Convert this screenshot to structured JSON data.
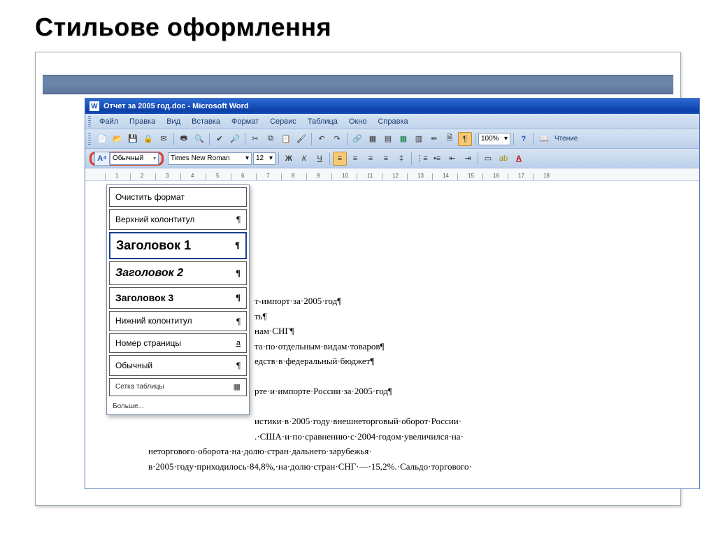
{
  "slide": {
    "title": "Стильове оформлення"
  },
  "window": {
    "title": "Отчет за 2005 год.doc - Microsoft Word"
  },
  "menu": {
    "file": "Файл",
    "edit": "Правка",
    "view": "Вид",
    "insert": "Вставка",
    "format": "Формат",
    "tools": "Сервис",
    "table": "Таблица",
    "window": "Окно",
    "help": "Справка"
  },
  "toolbar": {
    "zoom": "100%",
    "reading": "Чтение"
  },
  "format_bar": {
    "style": "Обычный",
    "font": "Times New Roman",
    "size": "12",
    "bold": "Ж",
    "italic": "К",
    "underline": "Ч"
  },
  "ruler": {
    "marks": [
      "1",
      "2",
      "3",
      "4",
      "5",
      "6",
      "7",
      "8",
      "9",
      "10",
      "11",
      "12",
      "13",
      "14",
      "15",
      "16",
      "17",
      "18"
    ]
  },
  "style_dropdown": {
    "clear": "Очистить формат",
    "header_top": "Верхний колонтитул",
    "h1": "Заголовок 1",
    "h2": "Заголовок 2",
    "h3": "Заголовок 3",
    "header_bottom": "Нижний колонтитул",
    "page_num": "Номер страницы",
    "normal": "Обычный",
    "table_grid": "Сетка таблицы",
    "more": "Больше..."
  },
  "document": {
    "lines": [
      "т-импорт·за·2005·год¶",
      "ть¶",
      "нам·СНГ¶",
      "та·по·отдельным·видам·товаров¶",
      "едств·в·федеральный·бюджет¶",
      "",
      "рте·и·импорте·России·за·2005·год¶",
      "",
      "истики·в·2005·году·внешнеторговый·оборот·России·",
      ".·США·и·по·сравнению·с·2004·годом·увеличился·на·"
    ],
    "full_lines": [
      "неторгового·оборота·на·долю·стран·дальнего·зарубежья·",
      "в·2005·году·приходилось·84,8%,·на·долю·стран·СНГ·—·15,2%.·Сальдо·торгового·"
    ]
  }
}
